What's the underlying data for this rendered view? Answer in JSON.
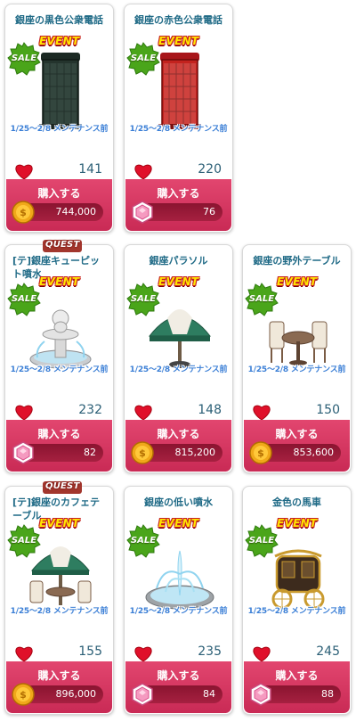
{
  "common": {
    "event_label": "EVENT",
    "sale_label": "SALE",
    "quest_label": "QUEST",
    "maintenance_note": "1/25〜2/8 メンテナンス前",
    "buy_label": "購入する"
  },
  "items": [
    {
      "name": "銀座の黒色公衆電話",
      "likes": "141",
      "price": "744,000",
      "currency": "coin-icon",
      "quest": false
    },
    {
      "name": "銀座の赤色公衆電話",
      "likes": "220",
      "price": "76",
      "currency": "gem-icon",
      "quest": false
    },
    {
      "name": "[テ]銀座キューピット噴水",
      "likes": "232",
      "price": "82",
      "currency": "gem-icon",
      "quest": true
    },
    {
      "name": "銀座パラソル",
      "likes": "148",
      "price": "815,200",
      "currency": "coin-icon",
      "quest": false
    },
    {
      "name": "銀座の野外テーブル",
      "likes": "150",
      "price": "853,600",
      "currency": "coin-icon",
      "quest": false
    },
    {
      "name": "[テ]銀座のカフェテーブル",
      "likes": "155",
      "price": "896,000",
      "currency": "coin-icon",
      "quest": true
    },
    {
      "name": "銀座の低い噴水",
      "likes": "235",
      "price": "84",
      "currency": "gem-icon",
      "quest": false
    },
    {
      "name": "金色の馬車",
      "likes": "245",
      "price": "88",
      "currency": "gem-icon",
      "quest": false
    }
  ],
  "colors": {
    "title": "#1f6a86",
    "buy_bg": "#d43560",
    "price_bar": "#9a1b39",
    "heart": "#e0102a",
    "maintenance": "#3b7fd6"
  }
}
